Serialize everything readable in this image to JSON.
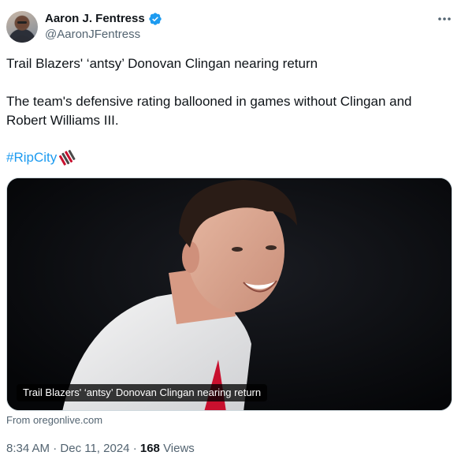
{
  "author": {
    "display_name": "Aaron J. Fentress",
    "handle": "@AaronJFentress",
    "verified": true,
    "avatar_icon": "user-avatar"
  },
  "tweet": {
    "headline": "Trail Blazers' ‘antsy’ Donovan Clingan nearing return",
    "body_line1": "The team's defensive rating ballooned in games without Clingan and",
    "body_line2": "Robert Williams III.",
    "hashtag": "#RipCity",
    "hashtag_emoji_icon": "trail-blazers-pinwheel-icon"
  },
  "link_card": {
    "title": "Trail Blazers' ‘antsy’ Donovan Clingan nearing return",
    "source": "From oregonlive.com"
  },
  "meta": {
    "time": "8:34 AM",
    "sep1": "·",
    "date": "Dec 11, 2024",
    "sep2": "·",
    "views_count": "168",
    "views_label": "Views"
  },
  "more_icon": "more-horizontal-icon",
  "colors": {
    "accent": "#1d9bf0",
    "secondary_text": "#536471",
    "primary_text": "#0f1419"
  }
}
